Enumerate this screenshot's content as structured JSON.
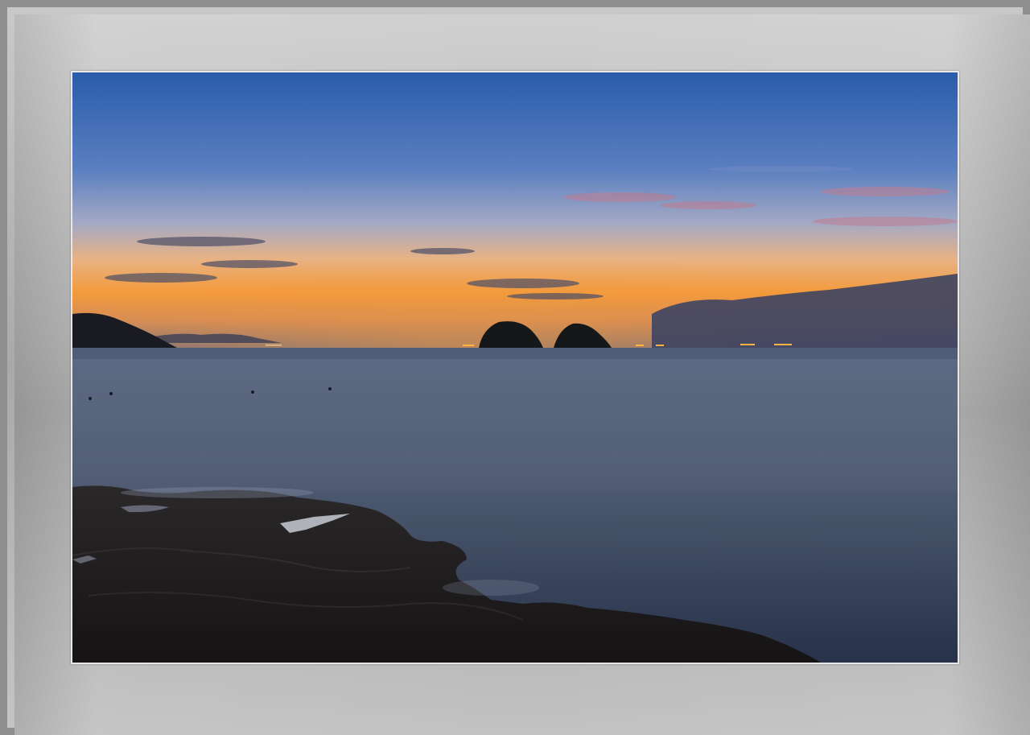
{
  "image": {
    "subject": "seascape-at-dusk",
    "palette": {
      "sky_top": "#2e5fae",
      "sky_mid": "#6a86bf",
      "horizon_glow": "#f0933a",
      "water": "#2f3d54",
      "rocks": "#1c1a1c",
      "frame": "#a8a8a8"
    }
  }
}
